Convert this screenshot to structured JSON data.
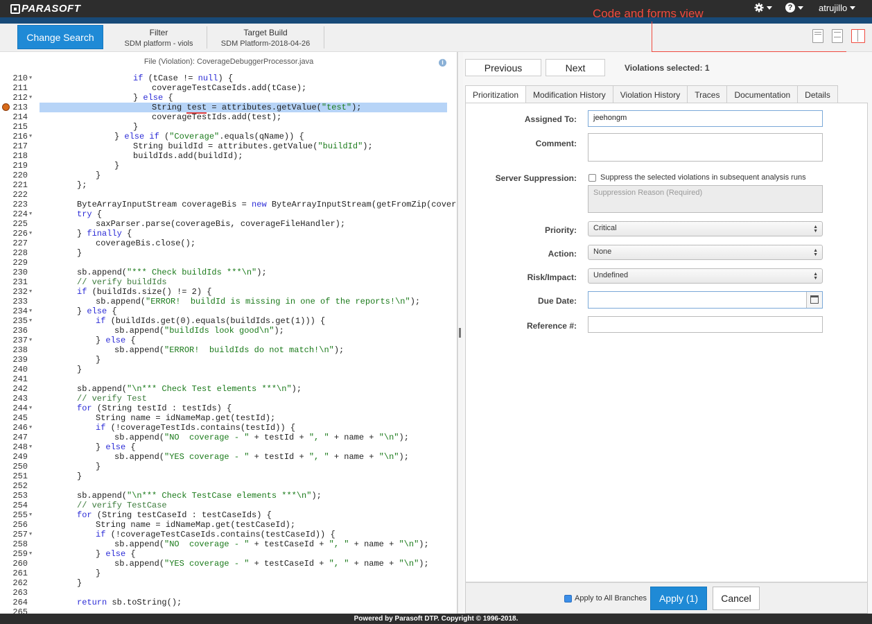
{
  "app": {
    "logo": "PARASOFT",
    "user": "atrujillo",
    "settings_icon": "gear-icon",
    "help_icon": "question-icon"
  },
  "subbar": {
    "change_search": "Change Search",
    "filter_title": "Filter",
    "filter_value": "SDM platform - viols",
    "target_title": "Target Build",
    "target_value": "SDM Platform-2018-04-26",
    "annotation": "Code and forms view"
  },
  "code": {
    "file_title": "File (Violation): CoverageDebuggerProcessor.java",
    "lines": [
      {
        "n": "210",
        "f": true,
        "i": 5,
        "t": "if (tCase != null) {"
      },
      {
        "n": "211",
        "f": false,
        "i": 6,
        "t": "coverageTestCaseIds.add(tCase);"
      },
      {
        "n": "212",
        "f": true,
        "i": 5,
        "t": "} else {"
      },
      {
        "n": "213",
        "f": false,
        "i": 6,
        "t": "String test = attributes.getValue(\"test\");",
        "hl": true,
        "bug": true
      },
      {
        "n": "214",
        "f": false,
        "i": 6,
        "t": "coverageTestIds.add(test);"
      },
      {
        "n": "215",
        "f": false,
        "i": 5,
        "t": "}"
      },
      {
        "n": "216",
        "f": true,
        "i": 4,
        "t": "} else if (\"Coverage\".equals(qName)) {"
      },
      {
        "n": "217",
        "f": false,
        "i": 5,
        "t": "String buildId = attributes.getValue(\"buildId\");"
      },
      {
        "n": "218",
        "f": false,
        "i": 5,
        "t": "buildIds.add(buildId);"
      },
      {
        "n": "219",
        "f": false,
        "i": 4,
        "t": "}"
      },
      {
        "n": "220",
        "f": false,
        "i": 3,
        "t": "}"
      },
      {
        "n": "221",
        "f": false,
        "i": 2,
        "t": "};"
      },
      {
        "n": "222",
        "f": false,
        "i": 0,
        "t": ""
      },
      {
        "n": "223",
        "f": false,
        "i": 2,
        "t": "ByteArrayInputStream coverageBis = new ByteArrayInputStream(getFromZip(coverageFi"
      },
      {
        "n": "224",
        "f": true,
        "i": 2,
        "t": "try {"
      },
      {
        "n": "225",
        "f": false,
        "i": 3,
        "t": "saxParser.parse(coverageBis, coverageFileHandler);"
      },
      {
        "n": "226",
        "f": true,
        "i": 2,
        "t": "} finally {"
      },
      {
        "n": "227",
        "f": false,
        "i": 3,
        "t": "coverageBis.close();"
      },
      {
        "n": "228",
        "f": false,
        "i": 2,
        "t": "}"
      },
      {
        "n": "229",
        "f": false,
        "i": 0,
        "t": ""
      },
      {
        "n": "230",
        "f": false,
        "i": 2,
        "t": "sb.append(\"*** Check buildIds ***\\n\");"
      },
      {
        "n": "231",
        "f": false,
        "i": 2,
        "t": "// verify buildIds"
      },
      {
        "n": "232",
        "f": true,
        "i": 2,
        "t": "if (buildIds.size() != 2) {"
      },
      {
        "n": "233",
        "f": false,
        "i": 3,
        "t": "sb.append(\"ERROR!  buildId is missing in one of the reports!\\n\");"
      },
      {
        "n": "234",
        "f": true,
        "i": 2,
        "t": "} else {"
      },
      {
        "n": "235",
        "f": true,
        "i": 3,
        "t": "if (buildIds.get(0).equals(buildIds.get(1))) {"
      },
      {
        "n": "236",
        "f": false,
        "i": 4,
        "t": "sb.append(\"buildIds look good\\n\");"
      },
      {
        "n": "237",
        "f": true,
        "i": 3,
        "t": "} else {"
      },
      {
        "n": "238",
        "f": false,
        "i": 4,
        "t": "sb.append(\"ERROR!  buildIds do not match!\\n\");"
      },
      {
        "n": "239",
        "f": false,
        "i": 3,
        "t": "}"
      },
      {
        "n": "240",
        "f": false,
        "i": 2,
        "t": "}"
      },
      {
        "n": "241",
        "f": false,
        "i": 0,
        "t": ""
      },
      {
        "n": "242",
        "f": false,
        "i": 2,
        "t": "sb.append(\"\\n*** Check Test elements ***\\n\");"
      },
      {
        "n": "243",
        "f": false,
        "i": 2,
        "t": "// verify Test"
      },
      {
        "n": "244",
        "f": true,
        "i": 2,
        "t": "for (String testId : testIds) {"
      },
      {
        "n": "245",
        "f": false,
        "i": 3,
        "t": "String name = idNameMap.get(testId);"
      },
      {
        "n": "246",
        "f": true,
        "i": 3,
        "t": "if (!coverageTestIds.contains(testId)) {"
      },
      {
        "n": "247",
        "f": false,
        "i": 4,
        "t": "sb.append(\"NO  coverage - \" + testId + \", \" + name + \"\\n\");"
      },
      {
        "n": "248",
        "f": true,
        "i": 3,
        "t": "} else {"
      },
      {
        "n": "249",
        "f": false,
        "i": 4,
        "t": "sb.append(\"YES coverage - \" + testId + \", \" + name + \"\\n\");"
      },
      {
        "n": "250",
        "f": false,
        "i": 3,
        "t": "}"
      },
      {
        "n": "251",
        "f": false,
        "i": 2,
        "t": "}"
      },
      {
        "n": "252",
        "f": false,
        "i": 0,
        "t": ""
      },
      {
        "n": "253",
        "f": false,
        "i": 2,
        "t": "sb.append(\"\\n*** Check TestCase elements ***\\n\");"
      },
      {
        "n": "254",
        "f": false,
        "i": 2,
        "t": "// verify TestCase"
      },
      {
        "n": "255",
        "f": true,
        "i": 2,
        "t": "for (String testCaseId : testCaseIds) {"
      },
      {
        "n": "256",
        "f": false,
        "i": 3,
        "t": "String name = idNameMap.get(testCaseId);"
      },
      {
        "n": "257",
        "f": true,
        "i": 3,
        "t": "if (!coverageTestCaseIds.contains(testCaseId)) {"
      },
      {
        "n": "258",
        "f": false,
        "i": 4,
        "t": "sb.append(\"NO  coverage - \" + testCaseId + \", \" + name + \"\\n\");"
      },
      {
        "n": "259",
        "f": true,
        "i": 3,
        "t": "} else {"
      },
      {
        "n": "260",
        "f": false,
        "i": 4,
        "t": "sb.append(\"YES coverage - \" + testCaseId + \", \" + name + \"\\n\");"
      },
      {
        "n": "261",
        "f": false,
        "i": 3,
        "t": "}"
      },
      {
        "n": "262",
        "f": false,
        "i": 2,
        "t": "}"
      },
      {
        "n": "263",
        "f": false,
        "i": 0,
        "t": ""
      },
      {
        "n": "264",
        "f": false,
        "i": 2,
        "t": "return sb.toString();"
      },
      {
        "n": "265",
        "f": false,
        "i": 0,
        "t": ""
      }
    ]
  },
  "nav": {
    "previous": "Previous",
    "next": "Next",
    "violations_selected": "Violations selected: 1"
  },
  "tabs": [
    "Prioritization",
    "Modification History",
    "Violation History",
    "Traces",
    "Documentation",
    "Details"
  ],
  "form": {
    "assigned_label": "Assigned To:",
    "assigned_value": "jeehongm",
    "comment_label": "Comment:",
    "suppression_label": "Server Suppression:",
    "suppression_text": "Suppress the selected violations in subsequent analysis runs",
    "suppression_placeholder": "Suppression Reason (Required)",
    "priority_label": "Priority:",
    "priority_value": "Critical",
    "action_label": "Action:",
    "action_value": "None",
    "risk_label": "Risk/Impact:",
    "risk_value": "Undefined",
    "due_label": "Due Date:",
    "ref_label": "Reference #:"
  },
  "actions": {
    "apply_all": "Apply to All Branches",
    "apply": "Apply (1)",
    "cancel": "Cancel"
  },
  "footer": "Powered by Parasoft DTP. Copyright © 1996-2018."
}
